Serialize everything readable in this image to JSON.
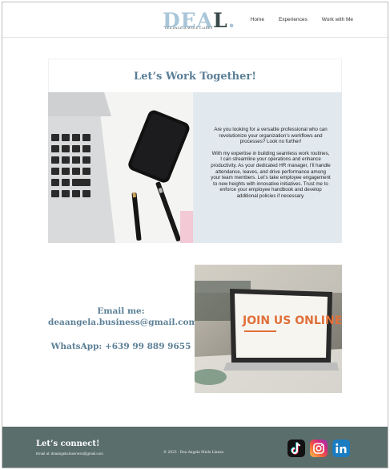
{
  "header": {
    "logo": {
      "text": "DEAL",
      "subtitle": "DEA ANGELA MIOLE LLANES"
    },
    "nav": [
      {
        "label": "Home"
      },
      {
        "label": "Experiences"
      },
      {
        "label": "Work with Me"
      }
    ]
  },
  "work_section": {
    "title": "Let’s Work Together!",
    "paragraphs": [
      "Are you looking for a versatile professional who can revolutionize your organization’s workflows and processes? Look no further!",
      "With my expertise in building seamless work routines, I can streamline your operations and enhance productivity. As your dedicated HR manager, I’ll handle attendance, leaves, and drive performance among your team members. Let’s take employee engagement to new heights with innovative initiatives. Trust me to enforce your employee handbook and develop additional policies if necessary."
    ],
    "image_icon": "laptop-phone-desk-photo"
  },
  "contact_section": {
    "email_label": "Email me:",
    "email": "deaangela.business@gmail.com",
    "whatsapp": "WhatsApp: +639 99 889 9655",
    "image_text": "JOIN US ONLINE."
  },
  "footer": {
    "title": "Let’s connect!",
    "email_line": "Email at: deaangela.business@gmail.com",
    "copyright": "© 2023 - Dea Angela Miole Llanes",
    "icons": [
      "tiktok-icon",
      "instagram-icon",
      "linkedin-icon"
    ]
  },
  "colors": {
    "accent": "#5b7f96",
    "footer_bg": "#5a6e6b",
    "panel_bg": "#e2e9ee"
  }
}
